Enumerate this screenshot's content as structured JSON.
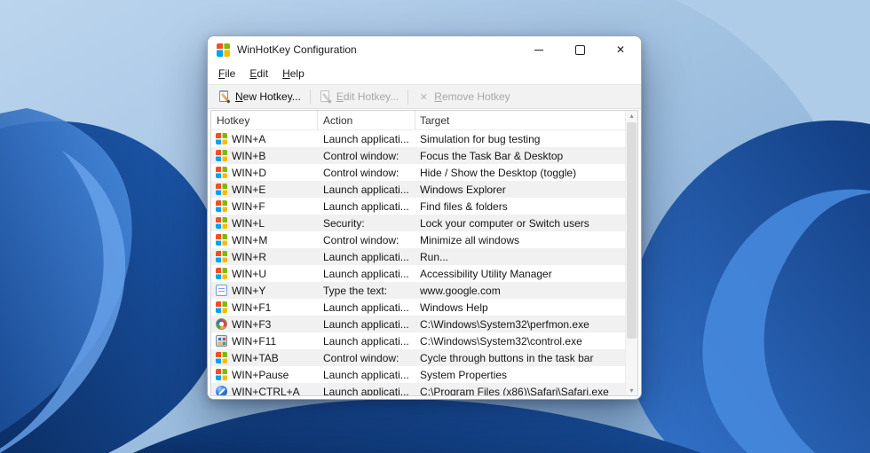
{
  "window": {
    "title": "WinHotKey Configuration",
    "menu": [
      {
        "label": "File"
      },
      {
        "label": "Edit"
      },
      {
        "label": "Help"
      }
    ],
    "toolbar": {
      "buttons": [
        {
          "label": "New Hotkey...",
          "icon": "new-hotkey-icon",
          "enabled": true
        },
        {
          "label": "Edit Hotkey...",
          "icon": "edit-hotkey-icon",
          "enabled": false
        },
        {
          "label": "Remove Hotkey",
          "icon": "remove-hotkey-icon",
          "enabled": false
        }
      ]
    },
    "list": {
      "columns": [
        {
          "label": "Hotkey"
        },
        {
          "label": "Action"
        },
        {
          "label": "Target"
        }
      ],
      "rows": [
        {
          "icon": "windows-flag-icon",
          "hotkey": "WIN+A",
          "action": "Launch applicati...",
          "target": "Simulation for bug testing"
        },
        {
          "icon": "windows-flag-icon",
          "hotkey": "WIN+B",
          "action": "Control window:",
          "target": "Focus the Task Bar & Desktop"
        },
        {
          "icon": "windows-flag-icon",
          "hotkey": "WIN+D",
          "action": "Control window:",
          "target": "Hide / Show the Desktop (toggle)"
        },
        {
          "icon": "windows-flag-icon",
          "hotkey": "WIN+E",
          "action": "Launch applicati...",
          "target": "Windows Explorer"
        },
        {
          "icon": "windows-flag-icon",
          "hotkey": "WIN+F",
          "action": "Launch applicati...",
          "target": "Find files & folders"
        },
        {
          "icon": "windows-flag-icon",
          "hotkey": "WIN+L",
          "action": "Security:",
          "target": "Lock your computer or Switch users"
        },
        {
          "icon": "windows-flag-icon",
          "hotkey": "WIN+M",
          "action": "Control window:",
          "target": "Minimize all windows"
        },
        {
          "icon": "windows-flag-icon",
          "hotkey": "WIN+R",
          "action": "Launch applicati...",
          "target": "Run..."
        },
        {
          "icon": "windows-flag-icon",
          "hotkey": "WIN+U",
          "action": "Launch applicati...",
          "target": "Accessibility Utility Manager"
        },
        {
          "icon": "text-icon",
          "hotkey": "WIN+Y",
          "action": "Type the text:",
          "target": "www.google.com"
        },
        {
          "icon": "windows-flag-icon",
          "hotkey": "WIN+F1",
          "action": "Launch applicati...",
          "target": "Windows Help"
        },
        {
          "icon": "perfmon-icon",
          "hotkey": "WIN+F3",
          "action": "Launch applicati...",
          "target": "C:\\Windows\\System32\\perfmon.exe"
        },
        {
          "icon": "control-panel-icon",
          "hotkey": "WIN+F11",
          "action": "Launch applicati...",
          "target": "C:\\Windows\\System32\\control.exe"
        },
        {
          "icon": "windows-flag-icon",
          "hotkey": "WIN+TAB",
          "action": "Control window:",
          "target": "Cycle through buttons in the task bar"
        },
        {
          "icon": "windows-flag-icon",
          "hotkey": "WIN+Pause",
          "action": "Launch applicati...",
          "target": "System Properties"
        },
        {
          "icon": "safari-icon",
          "hotkey": "WIN+CTRL+A",
          "action": "Launch applicati...",
          "target": "C:\\Program Files (x86)\\Safari\\Safari.exe"
        }
      ]
    }
  },
  "colors": {
    "row_stripe": "#f1f1f1",
    "toolbar_bg": "#f2f2f2",
    "disabled_text": "#a7a7a7",
    "sky_light": "#b9d2ec",
    "bloom_dark": "#0b2f66",
    "bloom_mid": "#1e5cb3",
    "bloom_light": "#6aa4ec"
  }
}
